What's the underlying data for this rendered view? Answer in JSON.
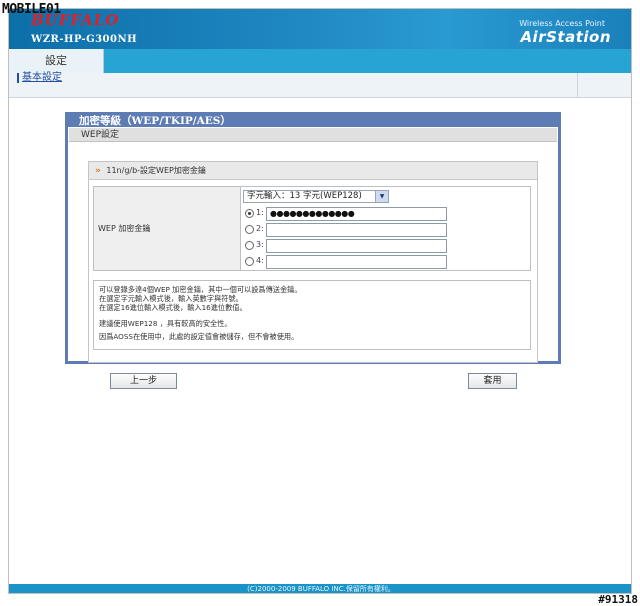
{
  "watermark": {
    "top": "MOBILE01",
    "bottom": "#91318"
  },
  "header": {
    "brand": "BUFFALO",
    "model": "WZR-HP-G300NH",
    "subtitle": "Wireless Access Point",
    "product": "AirStation"
  },
  "nav": {
    "main_tab": "設定",
    "sub_tab": "基本設定"
  },
  "panel": {
    "title": "加密等級（WEP/TKIP/AES）",
    "subtitle": "WEP設定",
    "section_title": "11n/g/b-設定WEP加密金鑰",
    "field_label": "WEP 加密金鑰",
    "input_type": {
      "selected": "字元輸入：13 字元(WEP128)"
    },
    "keys": [
      {
        "label": "1:",
        "value": "●●●●●●●●●●●●●",
        "checked": true
      },
      {
        "label": "2:",
        "value": "",
        "checked": false
      },
      {
        "label": "3:",
        "value": "",
        "checked": false
      },
      {
        "label": "4:",
        "value": "",
        "checked": false
      }
    ],
    "notes": [
      "可以登錄多達4個WEP 加密金鑰，其中一個可以設爲傳送金鑰。",
      "在選定字元輸入模式後，輸入英數字與符號。",
      "在選定16進位輸入模式後，輸入16進位數值。",
      "建議使用WEP128 ，具有較高的安全性。",
      "因爲AOSS在使用中，此處的設定值會被儲存，但不會被使用。"
    ]
  },
  "buttons": {
    "back": "上一步",
    "apply": "套用"
  },
  "footer": {
    "copyright": "(C)2000-2009 BUFFALO INC.保留所有權利。"
  },
  "colors": {
    "header": "#1f87c2",
    "panel": "#5e7cb4",
    "brand": "#e21f26",
    "accent": "#e77b1f"
  }
}
